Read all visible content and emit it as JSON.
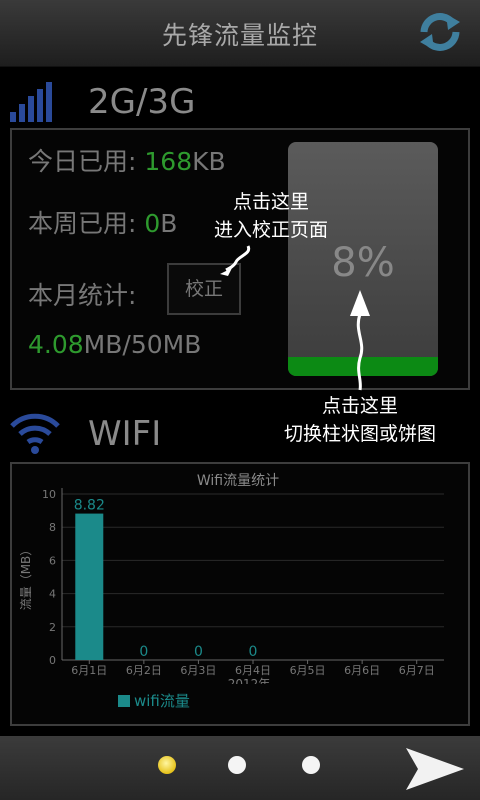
{
  "header": {
    "title": "先锋流量监控",
    "refresh_icon": "refresh-icon"
  },
  "mobile": {
    "section_label": "2G/3G",
    "today_label": "今日已用:",
    "today_value": "168",
    "today_unit": "KB",
    "week_label": "本周已用:",
    "week_value": "0",
    "week_unit": "B",
    "month_label": "本月统计:",
    "calibrate_button": "校正",
    "month_used": "4.08",
    "month_total": "MB/50MB",
    "gauge_percent": "8%",
    "gauge_fill_fraction": 0.08
  },
  "hints": {
    "calibrate_line1": "点击这里",
    "calibrate_line2": "进入校正页面",
    "toggle_line1": "点击这里",
    "toggle_line2": "切换柱状图或饼图"
  },
  "wifi": {
    "section_label": "WIFI"
  },
  "chart_data": {
    "type": "bar",
    "title": "Wifi流量统计",
    "ylabel": "流量（MB）",
    "xlabel": "2012年",
    "categories": [
      "6月1日",
      "6月2日",
      "6月3日",
      "6月4日",
      "6月5日",
      "6月6日",
      "6月7日"
    ],
    "series": [
      {
        "name": "wifi流量",
        "values": [
          8.82,
          0,
          0,
          0,
          null,
          null,
          null
        ],
        "labels": [
          "8.82",
          "0",
          "0",
          "0",
          "",
          "",
          ""
        ]
      }
    ],
    "ylim": [
      0,
      10
    ],
    "yticks": [
      "0",
      "2",
      "4",
      "6",
      "8",
      "10"
    ],
    "grid": true,
    "legend_position": "bottom-left",
    "color": "#1b8a8a"
  },
  "pager": {
    "count": 3,
    "active": 0,
    "next_icon": "arrow-right-icon"
  },
  "colors": {
    "green": "#2e9a2e",
    "gauge_fill": "#0c8a14",
    "teal": "#1b8a8a"
  }
}
